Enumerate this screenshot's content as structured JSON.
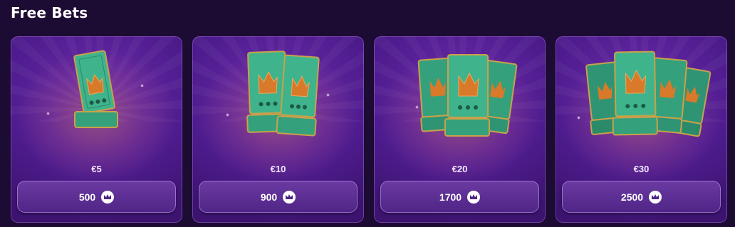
{
  "page": {
    "title": "Free Bets"
  },
  "cards": [
    {
      "price": "€5",
      "cost": "500",
      "tickets": 1,
      "currency_icon": "crown-coin-icon"
    },
    {
      "price": "€10",
      "cost": "900",
      "tickets": 2,
      "currency_icon": "crown-coin-icon"
    },
    {
      "price": "€20",
      "cost": "1700",
      "tickets": 3,
      "currency_icon": "crown-coin-icon"
    },
    {
      "price": "€30",
      "cost": "2500",
      "tickets": 4,
      "currency_icon": "crown-coin-icon"
    }
  ],
  "colors": {
    "background": "#1c0b33",
    "card": "#4e1c8e",
    "ticket": "#3fb38c",
    "ticket_trim": "#c9a24a",
    "crown": "#d9792a"
  }
}
